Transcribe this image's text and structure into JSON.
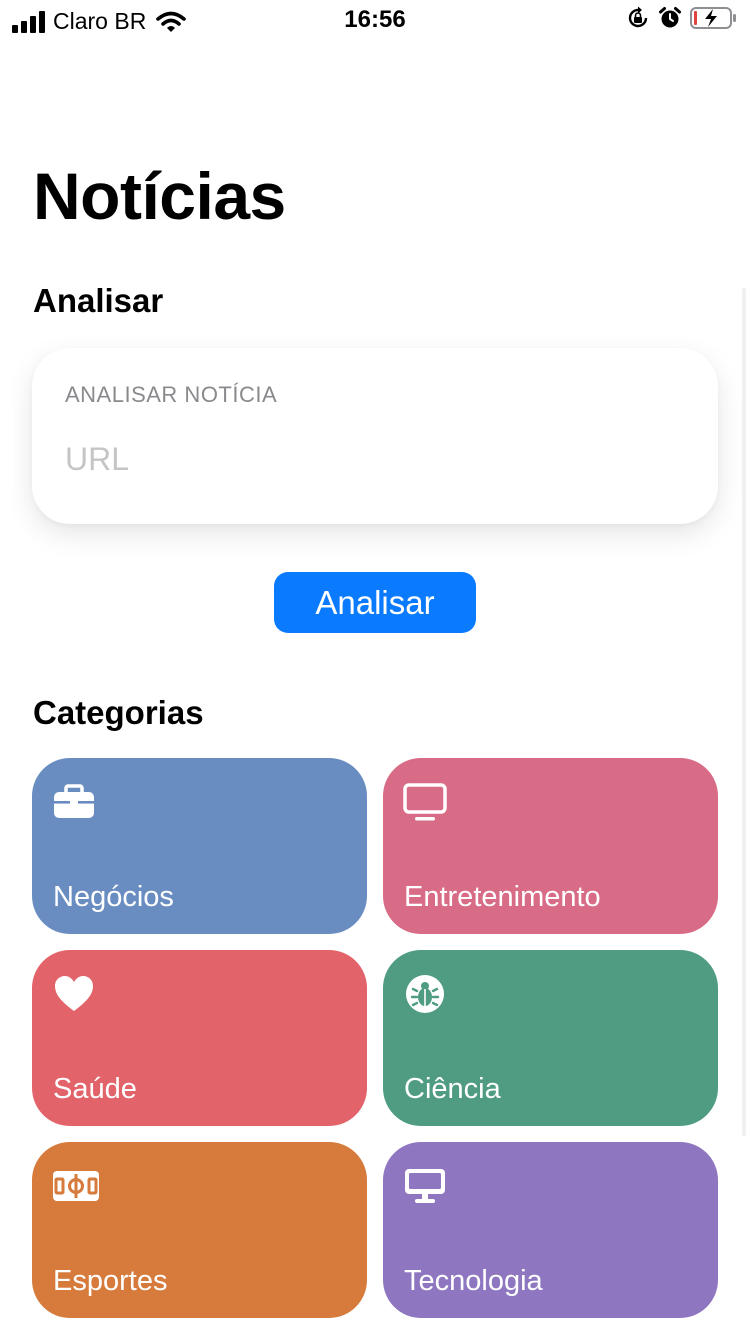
{
  "status_bar": {
    "carrier": "Claro BR",
    "time": "16:56",
    "icons": [
      "cellular-signal-icon",
      "wifi-icon",
      "rotation-lock-icon",
      "alarm-icon",
      "battery-charging-icon"
    ]
  },
  "title": "Notícias",
  "analyze_section": {
    "heading": "Analisar",
    "card_caption": "ANALISAR NOTÍCIA",
    "url_placeholder": "URL",
    "url_value": "",
    "button_label": "Analisar"
  },
  "categories_section": {
    "heading": "Categorias",
    "items": [
      {
        "label": "Negócios",
        "icon": "briefcase-icon",
        "color": "#6A8DC1"
      },
      {
        "label": "Entretenimento",
        "icon": "tv-icon",
        "color": "#D86B86"
      },
      {
        "label": "Saúde",
        "icon": "heart-icon",
        "color": "#E2636A"
      },
      {
        "label": "Ciência",
        "icon": "ladybug-icon",
        "color": "#4F9C82"
      },
      {
        "label": "Esportes",
        "icon": "sports-field-icon",
        "color": "#D67B3B"
      },
      {
        "label": "Tecnologia",
        "icon": "desktop-icon",
        "color": "#8E77C0"
      }
    ]
  },
  "colors": {
    "accent": "#0A7BFF",
    "background": "#FFFFFF"
  }
}
